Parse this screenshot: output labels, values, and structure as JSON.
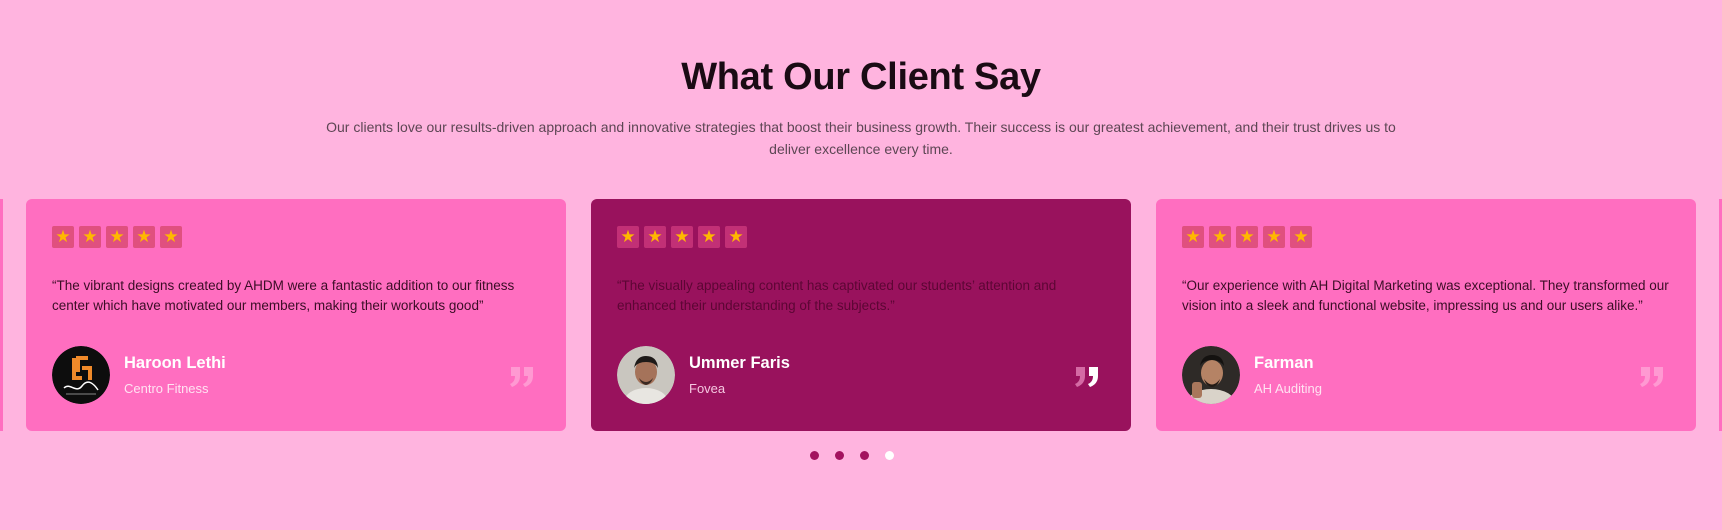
{
  "heading": {
    "title": "What Our Client Say",
    "subtitle": "Our clients love our results-driven approach and innovative strategies that boost their business growth. Their success is our greatest achievement, and their trust drives us to deliver excellence every time."
  },
  "testimonials": [
    {
      "rating": 5,
      "quote": "“The vibrant designs created by AHDM were a fantastic addition to our fitness center which have motivated our members, making their workouts good”",
      "name": "Haroon Lethi",
      "company": "Centro Fitness",
      "avatar": "centro-fitness-logo"
    },
    {
      "rating": 5,
      "quote": "“The visually appealing content has captivated our students’ attention and enhanced their understanding of the subjects.”",
      "name": "Ummer Faris",
      "company": "Fovea",
      "avatar": "profile-photo"
    },
    {
      "rating": 5,
      "quote": "“Our experience with AH Digital Marketing was exceptional. They transformed our vision into a sleek and functional website, impressing us and our users alike.”",
      "name": "Farman",
      "company": "AH Auditing",
      "avatar": "profile-photo"
    }
  ],
  "carousel": {
    "dot_count": 4,
    "current_dot": 4
  },
  "colors": {
    "background": "#ffb4df",
    "card": "#ff6ec0",
    "card_active": "#99125d",
    "star": "#ffb800",
    "dot": "#a3125f",
    "dot_current": "#ffffff"
  }
}
